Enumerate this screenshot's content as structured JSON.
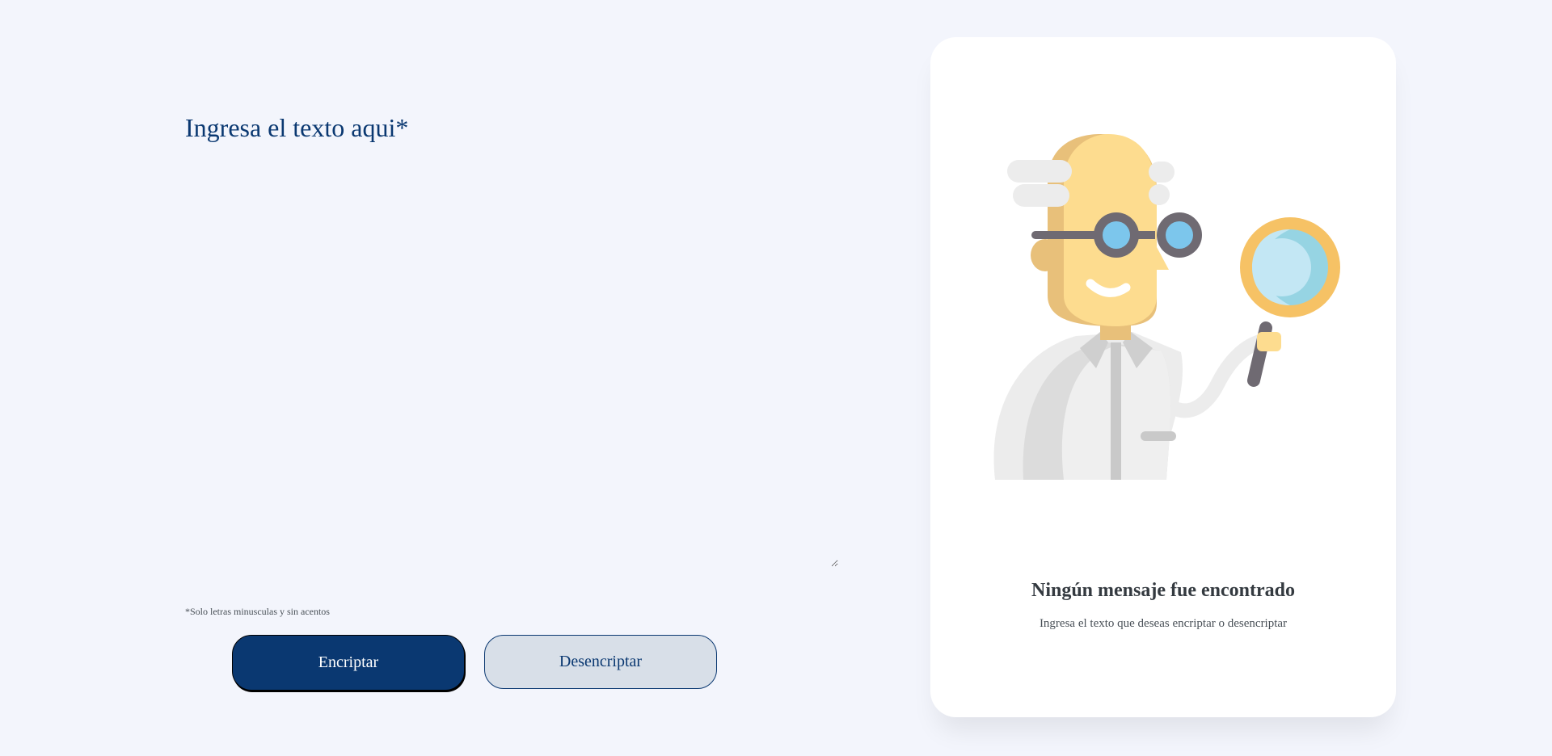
{
  "input": {
    "placeholder": "Ingresa el texto aqui*",
    "value": ""
  },
  "hint": {
    "text": "*Solo letras minusculas y sin acentos"
  },
  "buttons": {
    "encrypt_label": "Encriptar",
    "decrypt_label": "Desencriptar"
  },
  "output": {
    "title": "Ningún mensaje fue encontrado",
    "description": "Ingresa el texto que deseas encriptar o desencriptar",
    "illustration_icon": "scientist-with-magnifier-icon"
  },
  "colors": {
    "background": "#f3f5fc",
    "primary": "#0a3871",
    "secondary_button": "#d8dfe8",
    "card": "#ffffff"
  }
}
